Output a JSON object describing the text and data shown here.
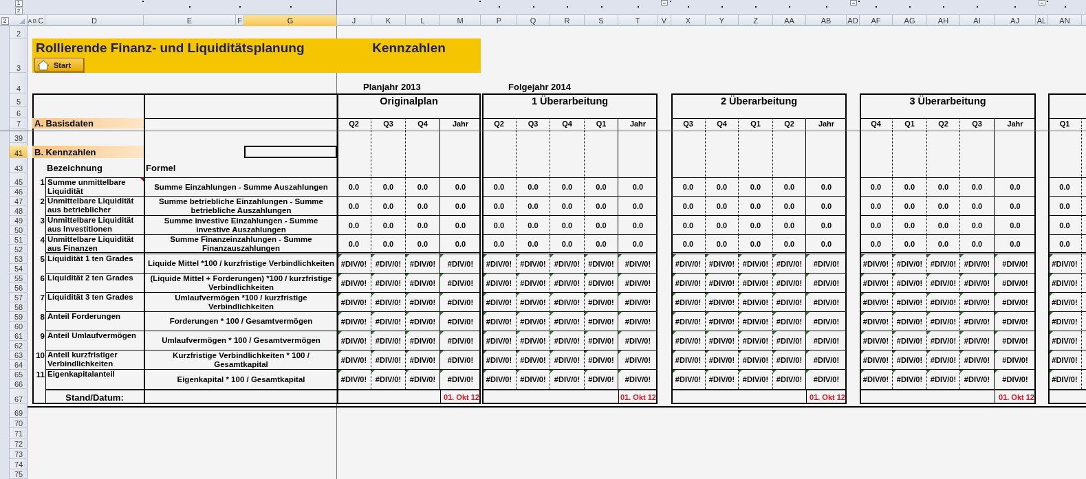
{
  "outline_buttons": {
    "column_levels": [
      "1",
      "2"
    ],
    "row_levels": [
      "2"
    ]
  },
  "column_headers": [
    {
      "label": "A",
      "selected": false,
      "kind": "plain"
    },
    {
      "label": "B",
      "selected": false,
      "kind": "plain"
    },
    {
      "label": "C",
      "selected": false,
      "kind": "plain"
    },
    {
      "label": "D",
      "selected": false,
      "kind": "edge"
    },
    {
      "label": "E",
      "selected": false,
      "kind": "dot"
    },
    {
      "label": "F",
      "selected": false,
      "kind": "dot"
    },
    {
      "label": "G",
      "selected": true,
      "kind": "dot"
    },
    {
      "label": "J",
      "selected": false,
      "kind": "plain"
    },
    {
      "label": "K",
      "selected": false,
      "kind": "plain"
    },
    {
      "label": "L",
      "selected": false,
      "kind": "plain"
    },
    {
      "label": "M",
      "selected": false,
      "kind": "edge"
    },
    {
      "label": "P",
      "selected": false,
      "kind": "dot"
    },
    {
      "label": "Q",
      "selected": false,
      "kind": "dot"
    },
    {
      "label": "R",
      "selected": false,
      "kind": "dot"
    },
    {
      "label": "S",
      "selected": false,
      "kind": "dot"
    },
    {
      "label": "T",
      "selected": false,
      "kind": "dot"
    },
    {
      "label": "V",
      "selected": false,
      "kind": "collapse"
    },
    {
      "label": "X",
      "selected": false,
      "kind": "dot"
    },
    {
      "label": "Y",
      "selected": false,
      "kind": "dot"
    },
    {
      "label": "Z",
      "selected": false,
      "kind": "dot"
    },
    {
      "label": "AA",
      "selected": false,
      "kind": "dot"
    },
    {
      "label": "AB",
      "selected": false,
      "kind": "dot"
    },
    {
      "label": "AD",
      "selected": false,
      "kind": "collapse"
    },
    {
      "label": "AF",
      "selected": false,
      "kind": "dot"
    },
    {
      "label": "AG",
      "selected": false,
      "kind": "dot"
    },
    {
      "label": "AH",
      "selected": false,
      "kind": "dot"
    },
    {
      "label": "AI",
      "selected": false,
      "kind": "dot"
    },
    {
      "label": "AJ",
      "selected": false,
      "kind": "dot"
    },
    {
      "label": "AL",
      "selected": false,
      "kind": "collapse"
    },
    {
      "label": "AN",
      "selected": false,
      "kind": "dot"
    }
  ],
  "row_headers": [
    {
      "label": "2",
      "selected": false
    },
    {
      "label": "3",
      "selected": false
    },
    {
      "label": "4",
      "selected": false
    },
    {
      "label": "5",
      "selected": false
    },
    {
      "label": "6",
      "selected": false
    },
    {
      "label": "7",
      "selected": false
    },
    {
      "label": "39",
      "selected": false
    },
    {
      "label": "41",
      "selected": true
    },
    {
      "label": "43",
      "selected": false
    },
    {
      "label": "45",
      "selected": false
    },
    {
      "label": "46",
      "selected": false
    },
    {
      "label": "47",
      "selected": false
    },
    {
      "label": "48",
      "selected": false
    },
    {
      "label": "49",
      "selected": false
    },
    {
      "label": "50",
      "selected": false
    },
    {
      "label": "51",
      "selected": false
    },
    {
      "label": "52",
      "selected": false
    },
    {
      "label": "53",
      "selected": false
    },
    {
      "label": "54",
      "selected": false
    },
    {
      "label": "55",
      "selected": false
    },
    {
      "label": "56",
      "selected": false
    },
    {
      "label": "57",
      "selected": false
    },
    {
      "label": "58",
      "selected": false
    },
    {
      "label": "59",
      "selected": false
    },
    {
      "label": "60",
      "selected": false
    },
    {
      "label": "61",
      "selected": false
    },
    {
      "label": "62",
      "selected": false
    },
    {
      "label": "63",
      "selected": false
    },
    {
      "label": "64",
      "selected": false
    },
    {
      "label": "65",
      "selected": false
    },
    {
      "label": "66",
      "selected": false
    },
    {
      "label": "67",
      "selected": false
    },
    {
      "label": "69",
      "selected": false
    },
    {
      "label": "70",
      "selected": false
    },
    {
      "label": "71",
      "selected": false
    },
    {
      "label": "72",
      "selected": false
    },
    {
      "label": "73",
      "selected": false
    },
    {
      "label": "74",
      "selected": false
    },
    {
      "label": "75",
      "selected": false
    }
  ],
  "banner": {
    "title": "Rollierende Finanz- und Liquiditätsplanung",
    "button": "Start",
    "subtitle": "Kennzahlen"
  },
  "left_table": {
    "section_a": "A. Basisdaten",
    "section_b": "B. Kennzahlen",
    "column_headings": [
      "Bezeichnung",
      "Formel"
    ],
    "footer_label": "Stand/Datum:"
  },
  "sections": [
    {
      "year": "Planjahr 2013",
      "title": "Originalplan",
      "quarters": [
        "Q2",
        "Q3",
        "Q4",
        "Jahr"
      ],
      "date": "01. Okt 12"
    },
    {
      "year": "Folgejahr 2014",
      "title": "1 Überarbeitung",
      "quarters": [
        "Q2",
        "Q3",
        "Q4",
        "Q1",
        "Jahr"
      ],
      "date": "01. Okt 12"
    },
    {
      "title": "2 Überarbeitung",
      "quarters": [
        "Q3",
        "Q4",
        "Q1",
        "Q2",
        "Jahr"
      ],
      "date": "01. Okt 12"
    },
    {
      "title": "3 Überarbeitung",
      "quarters": [
        "Q4",
        "Q1",
        "Q2",
        "Q3",
        "Jahr"
      ],
      "date": "01. Okt 12"
    },
    {
      "quarters": [
        "Q1"
      ]
    }
  ],
  "indicator_groups": [
    {
      "indicators": [
        {
          "number": "1",
          "name": "Summe unmittelbare Liquidität",
          "formula": "Summe Einzahlungen - Summe Auszahlungen",
          "comment": true,
          "error_flag": false,
          "values": [
            [
              "0.0",
              "0.0",
              "0.0",
              "0.0"
            ],
            [
              "0.0",
              "0.0",
              "0.0",
              "0.0",
              "0.0"
            ],
            [
              "0.0",
              "0.0",
              "0.0",
              "0.0",
              "0.0"
            ],
            [
              "0.0",
              "0.0",
              "0.0",
              "0.0",
              "0.0"
            ],
            [
              "0.0"
            ]
          ]
        },
        {
          "number": "2",
          "name": "Unmittelbare Liquidität aus betrieblicher",
          "formula": "Summe betriebliche Einzahlungen - Summe betriebliche Auszahlungen",
          "comment": false,
          "error_flag": false,
          "values": [
            [
              "0.0",
              "0.0",
              "0.0",
              "0.0"
            ],
            [
              "0.0",
              "0.0",
              "0.0",
              "0.0",
              "0.0"
            ],
            [
              "0.0",
              "0.0",
              "0.0",
              "0.0",
              "0.0"
            ],
            [
              "0.0",
              "0.0",
              "0.0",
              "0.0",
              "0.0"
            ],
            [
              "0.0"
            ]
          ]
        },
        {
          "number": "3",
          "name": "Unmittelbare Liquidität aus Investitionen",
          "formula": "Summe investive Einzahlungen - Summe investive Auszahlungen",
          "comment": false,
          "error_flag": false,
          "values": [
            [
              "0.0",
              "0.0",
              "0.0",
              "0.0"
            ],
            [
              "0.0",
              "0.0",
              "0.0",
              "0.0",
              "0.0"
            ],
            [
              "0.0",
              "0.0",
              "0.0",
              "0.0",
              "0.0"
            ],
            [
              "0.0",
              "0.0",
              "0.0",
              "0.0",
              "0.0"
            ],
            [
              "0.0"
            ]
          ]
        },
        {
          "number": "4",
          "name": "Unmittelbare Liquidität aus Finanzen",
          "formula": "Summe Finanzeinzahlungen - Summe Finanzauszahlungen",
          "comment": false,
          "error_flag": false,
          "values": [
            [
              "0.0",
              "0.0",
              "0.0",
              "0.0"
            ],
            [
              "0.0",
              "0.0",
              "0.0",
              "0.0",
              "0.0"
            ],
            [
              "0.0",
              "0.0",
              "0.0",
              "0.0",
              "0.0"
            ],
            [
              "0.0",
              "0.0",
              "0.0",
              "0.0",
              "0.0"
            ],
            [
              "0.0"
            ]
          ]
        }
      ]
    },
    {
      "indicators": [
        {
          "number": "5",
          "name": "Liquidität 1 ten Grades",
          "formula": "Liquide Mittel *100 / kurzfristige Verbindlichkeiten",
          "comment": false,
          "error_flag": true,
          "values": [
            [
              "#DIV/0!",
              "#DIV/0!",
              "#DIV/0!",
              "#DIV/0!"
            ],
            [
              "#DIV/0!",
              "#DIV/0!",
              "#DIV/0!",
              "#DIV/0!",
              "#DIV/0!"
            ],
            [
              "#DIV/0!",
              "#DIV/0!",
              "#DIV/0!",
              "#DIV/0!",
              "#DIV/0!"
            ],
            [
              "#DIV/0!",
              "#DIV/0!",
              "#DIV/0!",
              "#DIV/0!",
              "#DIV/0!"
            ],
            [
              "#DIV/0!"
            ]
          ]
        },
        {
          "number": "6",
          "name": "Liquidität 2 ten Grades",
          "formula": "(Liquide Mittel + Forderungen) *100 / kurzfristige Verbindlichkeiten",
          "comment": false,
          "error_flag": true,
          "values": [
            [
              "#DIV/0!",
              "#DIV/0!",
              "#DIV/0!",
              "#DIV/0!"
            ],
            [
              "#DIV/0!",
              "#DIV/0!",
              "#DIV/0!",
              "#DIV/0!",
              "#DIV/0!"
            ],
            [
              "#DIV/0!",
              "#DIV/0!",
              "#DIV/0!",
              "#DIV/0!",
              "#DIV/0!"
            ],
            [
              "#DIV/0!",
              "#DIV/0!",
              "#DIV/0!",
              "#DIV/0!",
              "#DIV/0!"
            ],
            [
              "#DIV/0!"
            ]
          ]
        },
        {
          "number": "7",
          "name": "Liquidität 3 ten Grades",
          "formula": "Umlaufvermögen *100 / kurzfristige Verbindlichkeiten",
          "comment": false,
          "error_flag": true,
          "values": [
            [
              "#DIV/0!",
              "#DIV/0!",
              "#DIV/0!",
              "#DIV/0!"
            ],
            [
              "#DIV/0!",
              "#DIV/0!",
              "#DIV/0!",
              "#DIV/0!",
              "#DIV/0!"
            ],
            [
              "#DIV/0!",
              "#DIV/0!",
              "#DIV/0!",
              "#DIV/0!",
              "#DIV/0!"
            ],
            [
              "#DIV/0!",
              "#DIV/0!",
              "#DIV/0!",
              "#DIV/0!",
              "#DIV/0!"
            ],
            [
              "#DIV/0!"
            ]
          ]
        },
        {
          "number": "8",
          "name": "Anteil Forderungen",
          "formula": "Forderungen * 100 / Gesamtvermögen",
          "comment": false,
          "error_flag": true,
          "values": [
            [
              "#DIV/0!",
              "#DIV/0!",
              "#DIV/0!",
              "#DIV/0!"
            ],
            [
              "#DIV/0!",
              "#DIV/0!",
              "#DIV/0!",
              "#DIV/0!",
              "#DIV/0!"
            ],
            [
              "#DIV/0!",
              "#DIV/0!",
              "#DIV/0!",
              "#DIV/0!",
              "#DIV/0!"
            ],
            [
              "#DIV/0!",
              "#DIV/0!",
              "#DIV/0!",
              "#DIV/0!",
              "#DIV/0!"
            ],
            [
              "#DIV/0!"
            ]
          ]
        },
        {
          "number": "9",
          "name": "Anteil Umlaufvermögen",
          "formula": "Umlaufvermögen * 100 / Gesamtvermögen",
          "comment": false,
          "error_flag": true,
          "values": [
            [
              "#DIV/0!",
              "#DIV/0!",
              "#DIV/0!",
              "#DIV/0!"
            ],
            [
              "#DIV/0!",
              "#DIV/0!",
              "#DIV/0!",
              "#DIV/0!",
              "#DIV/0!"
            ],
            [
              "#DIV/0!",
              "#DIV/0!",
              "#DIV/0!",
              "#DIV/0!",
              "#DIV/0!"
            ],
            [
              "#DIV/0!",
              "#DIV/0!",
              "#DIV/0!",
              "#DIV/0!",
              "#DIV/0!"
            ],
            [
              "#DIV/0!"
            ]
          ]
        },
        {
          "number": "10",
          "name": "Anteil kurzfristiger Verbindlichkeiten",
          "formula": "Kurzfristige Verbindlichkeiten * 100 / Gesamtkapital",
          "comment": false,
          "error_flag": true,
          "values": [
            [
              "#DIV/0!",
              "#DIV/0!",
              "#DIV/0!",
              "#DIV/0!"
            ],
            [
              "#DIV/0!",
              "#DIV/0!",
              "#DIV/0!",
              "#DIV/0!",
              "#DIV/0!"
            ],
            [
              "#DIV/0!",
              "#DIV/0!",
              "#DIV/0!",
              "#DIV/0!",
              "#DIV/0!"
            ],
            [
              "#DIV/0!",
              "#DIV/0!",
              "#DIV/0!",
              "#DIV/0!",
              "#DIV/0!"
            ],
            [
              "#DIV/0!"
            ]
          ]
        },
        {
          "number": "11",
          "name": "Eigenkapitalanteil",
          "formula": "Eigenkapital * 100 / Gesamtkapital",
          "comment": false,
          "error_flag": true,
          "values": [
            [
              "#DIV/0!",
              "#DIV/0!",
              "#DIV/0!",
              "#DIV/0!"
            ],
            [
              "#DIV/0!",
              "#DIV/0!",
              "#DIV/0!",
              "#DIV/0!",
              "#DIV/0!"
            ],
            [
              "#DIV/0!",
              "#DIV/0!",
              "#DIV/0!",
              "#DIV/0!",
              "#DIV/0!"
            ],
            [
              "#DIV/0!",
              "#DIV/0!",
              "#DIV/0!",
              "#DIV/0!",
              "#DIV/0!"
            ],
            [
              "#DIV/0!"
            ]
          ]
        }
      ]
    }
  ]
}
